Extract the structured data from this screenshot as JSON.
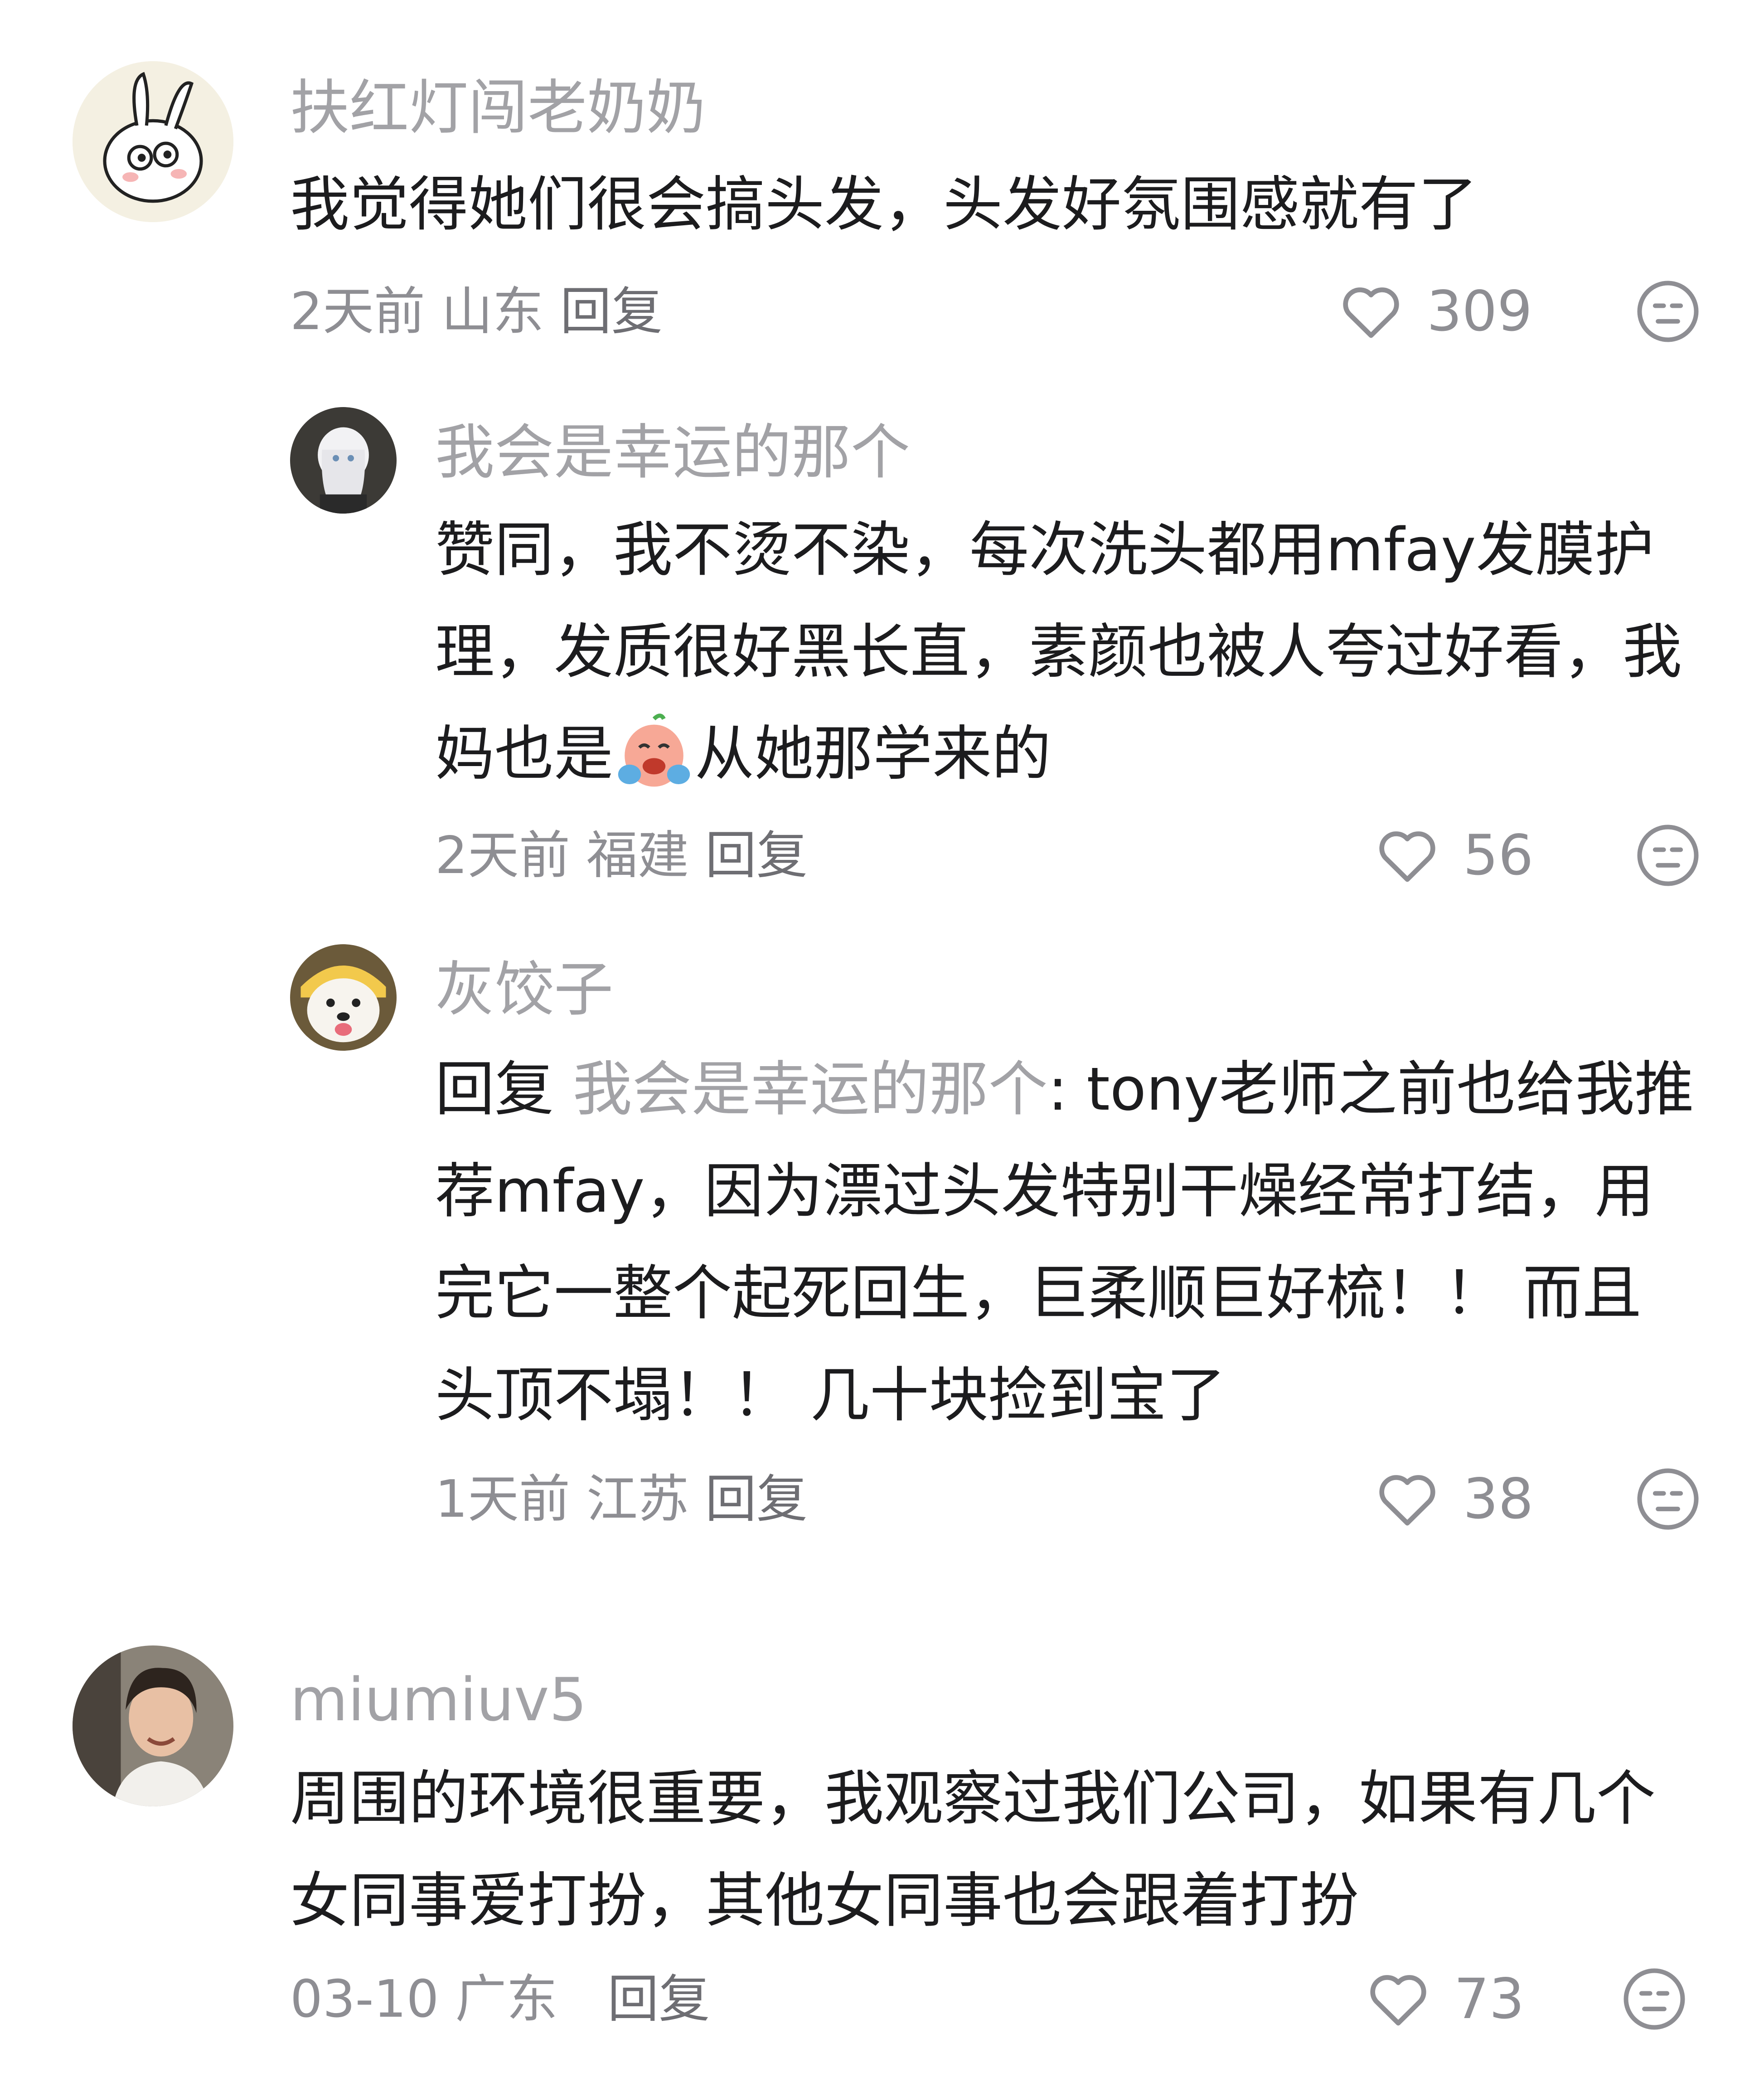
{
  "comments": [
    {
      "username": "扶红灯闯老奶奶",
      "text": "我觉得她们很会搞头发，头发好氛围感就有了",
      "time": "2天前",
      "location": "山东",
      "reply_label": "回复",
      "likes": "309",
      "avatar_icon": "bunny-avatar-icon"
    },
    {
      "username": "我会是幸运的那个",
      "text_before_emoji": "赞同，我不烫不染，每次洗头都用mfay发膜护理，发质很好黑长直，素颜也被人夸过好看，我妈也是",
      "emoji_icon": "crying-emoji-icon",
      "text_after_emoji": "从她那学来的",
      "time": "2天前",
      "location": "福建",
      "reply_label": "回复",
      "likes": "56",
      "avatar_icon": "anime-girl-avatar-icon"
    },
    {
      "username": "灰饺子",
      "reply_prefix": "回复 ",
      "reply_target": "我会是幸运的那个",
      "text": ": tony老师之前也给我推荐mfay，因为漂过头发特别干燥经常打结，用完它一整个起死回生，巨柔顺巨好梳！！ 而且头顶不塌！！ 几十块捡到宝了",
      "time": "1天前",
      "location": "江苏",
      "reply_label": "回复",
      "likes": "38",
      "avatar_icon": "dog-avatar-icon"
    },
    {
      "username": "miumiuv5",
      "text": "周围的环境很重要，我观察过我们公司，如果有几个女同事爱打扮，其他女同事也会跟着打扮",
      "time": "03-10",
      "location": "广东",
      "reply_label": "回复",
      "likes": "73",
      "avatar_icon": "woman-photo-avatar-icon"
    }
  ]
}
